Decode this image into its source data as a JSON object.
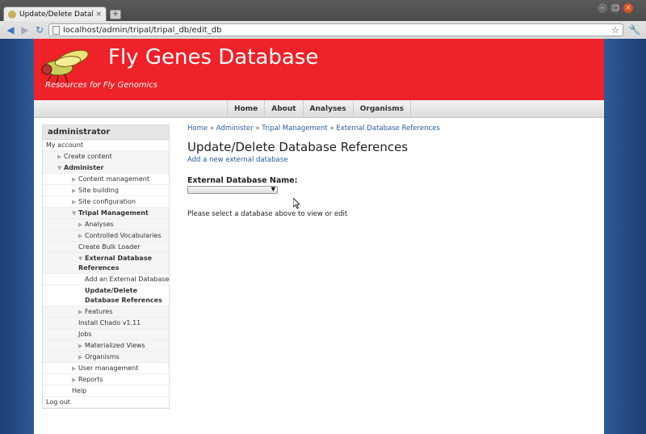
{
  "browser": {
    "tab_title": "Update/Delete Databa",
    "tab_close": "×",
    "new_tab": "+",
    "url": "localhost/admin/tripal/tripal_db/edit_db",
    "window_controls": [
      "–",
      "□",
      "×"
    ],
    "icons": {
      "back": "back-arrow-icon",
      "forward": "forward-arrow-icon",
      "reload": "reload-icon",
      "star": "bookmark-star-icon",
      "wrench": "wrench-icon"
    }
  },
  "site": {
    "name": "Fly Genes Database",
    "slogan": "Resources for Fly Genomics",
    "banner_color": "#ee2228"
  },
  "nav": {
    "items": [
      "Home",
      "About",
      "Analyses",
      "Organisms"
    ]
  },
  "sidebar": {
    "title": "administrator",
    "items": [
      {
        "label": "My account",
        "indent": 0,
        "arrow": "",
        "bold": false,
        "shaded": false
      },
      {
        "label": "Create content",
        "indent": 1,
        "arrow": "▶",
        "bold": false,
        "shaded": true
      },
      {
        "label": "Administer",
        "indent": 1,
        "arrow": "▼",
        "bold": true,
        "shaded": true
      },
      {
        "label": "Content management",
        "indent": 2,
        "arrow": "▶",
        "bold": false,
        "shaded": false
      },
      {
        "label": "Site building",
        "indent": 2,
        "arrow": "▶",
        "bold": false,
        "shaded": false
      },
      {
        "label": "Site configuration",
        "indent": 2,
        "arrow": "▶",
        "bold": false,
        "shaded": false
      },
      {
        "label": "Tripal Management",
        "indent": 2,
        "arrow": "▼",
        "bold": true,
        "shaded": true
      },
      {
        "label": "Analyses",
        "indent": 3,
        "arrow": "▶",
        "bold": false,
        "shaded": true
      },
      {
        "label": "Controlled Vocabularies",
        "indent": 3,
        "arrow": "▶",
        "bold": false,
        "shaded": true
      },
      {
        "label": "Create Bulk Loader",
        "indent": 3,
        "arrow": "",
        "bold": false,
        "shaded": true
      },
      {
        "label": "External Database References",
        "indent": 3,
        "arrow": "▼",
        "bold": true,
        "shaded": true,
        "tall": true
      },
      {
        "label": "Add an External Database",
        "indent": 4,
        "arrow": "",
        "bold": false,
        "shaded": false
      },
      {
        "label": "Update/Delete Database References",
        "indent": 4,
        "arrow": "",
        "bold": true,
        "shaded": false,
        "tall": true
      },
      {
        "label": "Features",
        "indent": 3,
        "arrow": "▶",
        "bold": false,
        "shaded": true
      },
      {
        "label": "Install Chado v1.11",
        "indent": 3,
        "arrow": "",
        "bold": false,
        "shaded": true
      },
      {
        "label": "Jobs",
        "indent": 3,
        "arrow": "",
        "bold": false,
        "shaded": true
      },
      {
        "label": "Materialized Views",
        "indent": 3,
        "arrow": "▶",
        "bold": false,
        "shaded": true
      },
      {
        "label": "Organisms",
        "indent": 3,
        "arrow": "▶",
        "bold": false,
        "shaded": true
      },
      {
        "label": "User management",
        "indent": 2,
        "arrow": "▶",
        "bold": false,
        "shaded": false
      },
      {
        "label": "Reports",
        "indent": 2,
        "arrow": "▶",
        "bold": false,
        "shaded": false
      },
      {
        "label": "Help",
        "indent": 2,
        "arrow": "",
        "bold": false,
        "shaded": false
      },
      {
        "label": "Log out",
        "indent": 0,
        "arrow": "",
        "bold": false,
        "shaded": false
      }
    ]
  },
  "main": {
    "breadcrumb": [
      "Home",
      "Administer",
      "Tripal Management",
      "External Database References"
    ],
    "breadcrumb_sep": "»",
    "title": "Update/Delete Database References",
    "add_link": "Add a new external database",
    "field_label": "External Database Name:",
    "select_value": "",
    "select_caret": "▼",
    "help_text": "Please select a database above to view or edit"
  }
}
